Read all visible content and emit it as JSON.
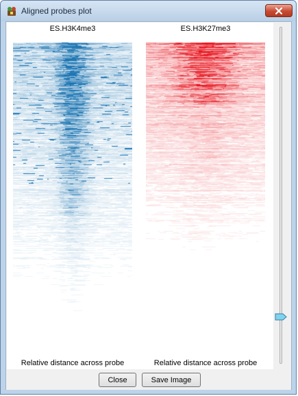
{
  "window": {
    "title": "Aligned probes plot",
    "icon": "seqmonk-app-icon",
    "close_icon": "close-x-icon"
  },
  "plots": [
    {
      "title": "ES.H3K4me3",
      "xlabel": "Relative distance across probe",
      "color": "#1f77b4"
    },
    {
      "title": "ES.H3K27me3",
      "xlabel": "Relative distance across probe",
      "color": "#e8141e"
    }
  ],
  "slider": {
    "level": 0.87
  },
  "buttons": {
    "close_label": "Close",
    "save_image_label": "Save Image"
  }
}
